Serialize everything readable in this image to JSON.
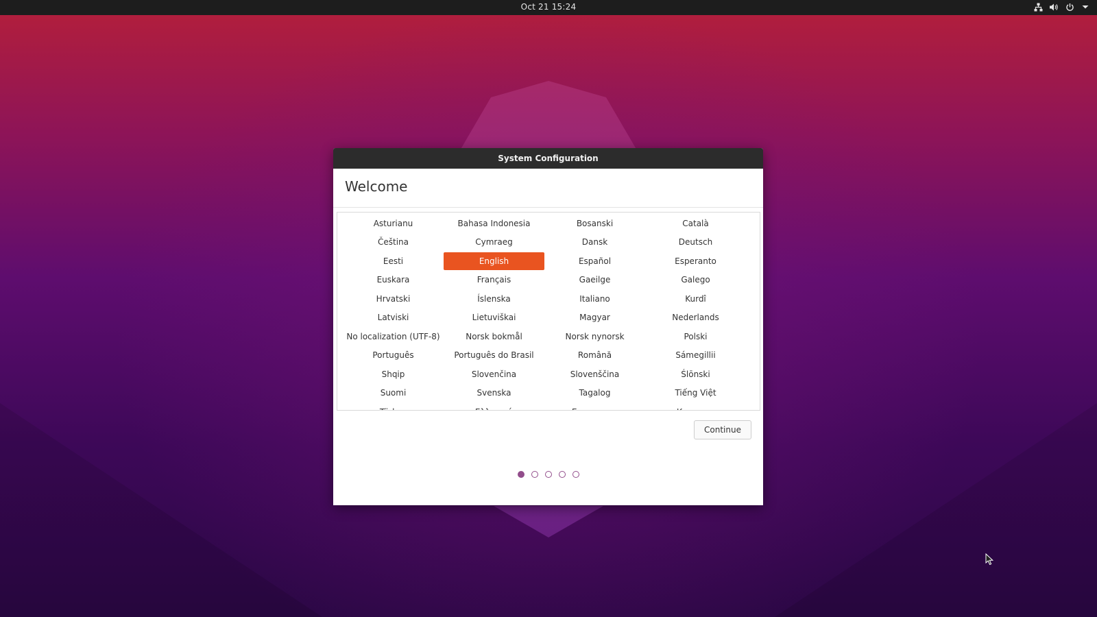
{
  "topbar": {
    "clock": "Oct 21  15:24",
    "icons": [
      "network-icon",
      "volume-icon",
      "power-icon",
      "menu-arrow-icon"
    ]
  },
  "dialog": {
    "title": "System Configuration",
    "heading": "Welcome",
    "continue_label": "Continue",
    "selected_language": "English",
    "page_count": 5,
    "current_page": 1
  },
  "languages": [
    "Asturianu",
    "Bahasa Indonesia",
    "Bosanski",
    "Català",
    "Čeština",
    "Cymraeg",
    "Dansk",
    "Deutsch",
    "Eesti",
    "English",
    "Español",
    "Esperanto",
    "Euskara",
    "Français",
    "Gaeilge",
    "Galego",
    "Hrvatski",
    "Íslenska",
    "Italiano",
    "Kurdî",
    "Latviski",
    "Lietuviškai",
    "Magyar",
    "Nederlands",
    "No localization (UTF-8)",
    "Norsk bokmål",
    "Norsk nynorsk",
    "Polski",
    "Português",
    "Português do Brasil",
    "Română",
    "Sámegillii",
    "Shqip",
    "Slovenčina",
    "Slovenščina",
    "Ślōnski",
    "Suomi",
    "Svenska",
    "Tagalog",
    "Tiếng Việt",
    "Türkçe",
    "Ελληνικά",
    "Български",
    "Қазақша"
  ],
  "colors": {
    "accent": "#e95420",
    "page_dot": "#924d8b",
    "titlebar": "#2c2c2c"
  }
}
